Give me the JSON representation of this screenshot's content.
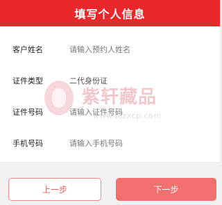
{
  "header": {
    "title": "填写个人信息"
  },
  "form": {
    "name": {
      "label": "客户姓名",
      "placeholder": "请输入预约人姓名"
    },
    "id_type": {
      "label": "证件类型",
      "value": "二代身份证"
    },
    "id_number": {
      "label": "证件号码",
      "placeholder": "请输入证件号码"
    },
    "phone": {
      "label": "手机号码",
      "placeholder": "请输入手机号码"
    }
  },
  "watermark": {
    "text": "紫轩藏品",
    "url": "www.bjzxcp.com"
  },
  "buttons": {
    "prev_label": "上一步",
    "next_label": "下一步"
  },
  "colors": {
    "header_bg": "#e8282b",
    "next_button_bg": "#f07070",
    "prev_button_border": "#f08a8a",
    "page_bg": "#f1f1f1"
  }
}
